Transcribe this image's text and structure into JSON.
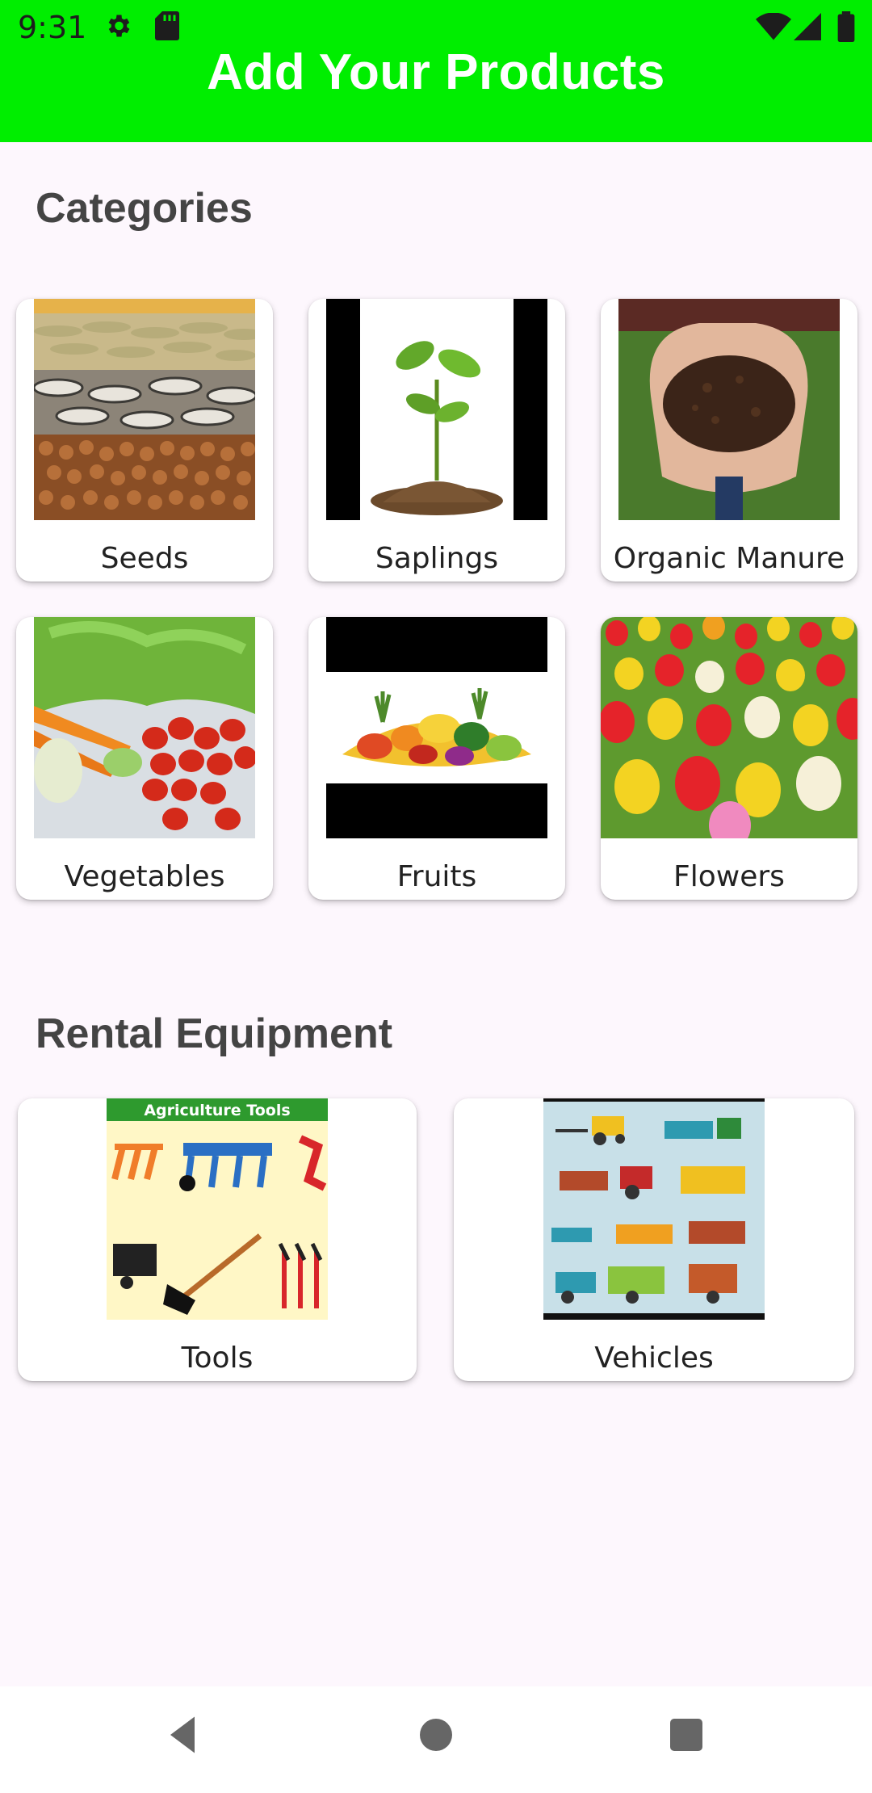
{
  "status_bar": {
    "time": "9:31"
  },
  "app_bar": {
    "title": "Add Your Products"
  },
  "categories": {
    "heading": "Categories",
    "items": [
      {
        "label": "Seeds",
        "icon": "seeds-image"
      },
      {
        "label": "Saplings",
        "icon": "sapling-image"
      },
      {
        "label": "Organic Manure",
        "icon": "manure-image"
      },
      {
        "label": "Vegetables",
        "icon": "vegetables-image"
      },
      {
        "label": "Fruits",
        "icon": "fruits-image"
      },
      {
        "label": "Flowers",
        "icon": "flowers-image"
      }
    ]
  },
  "rental": {
    "heading": "Rental Equipment",
    "items": [
      {
        "label": "Tools",
        "banner_text": "Agriculture Tools",
        "icon": "tools-image"
      },
      {
        "label": "Vehicles",
        "icon": "vehicles-image"
      }
    ]
  },
  "colors": {
    "app_bar": "#00ee00",
    "background": "#fdf7fd",
    "heading": "#444444"
  },
  "nav": {
    "back": "back-icon",
    "home": "home-icon",
    "recents": "recents-icon"
  }
}
